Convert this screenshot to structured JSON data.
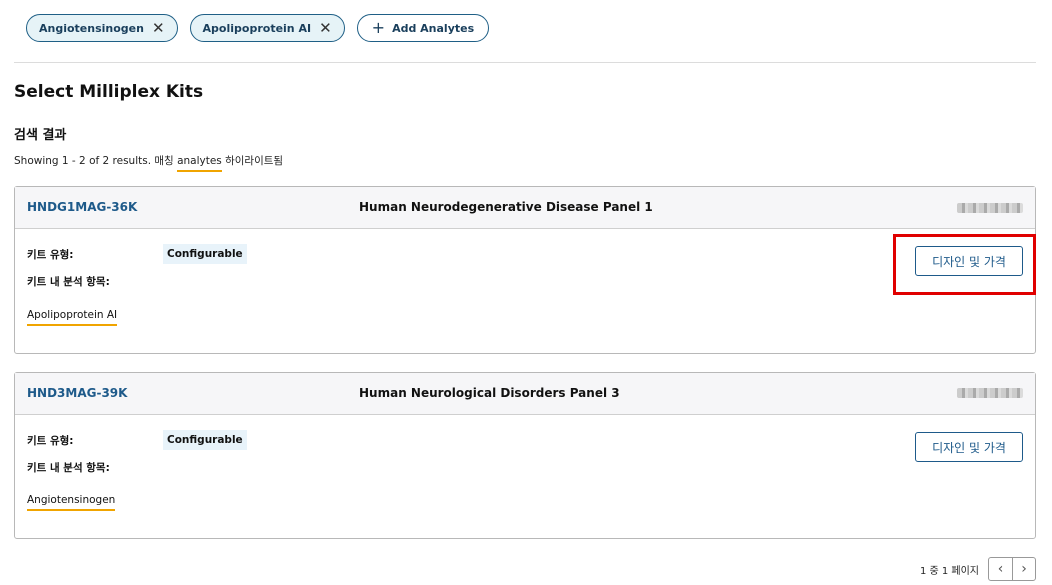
{
  "chips": [
    {
      "label": "Angiotensinogen",
      "remove_icon": "close-icon"
    },
    {
      "label": "Apolipoprotein AI",
      "remove_icon": "close-icon"
    }
  ],
  "add_chip": {
    "label": "Add Analytes",
    "icon": "plus-icon"
  },
  "title": "Select Milliplex Kits",
  "results_heading": "검색 결과",
  "summary": {
    "prefix": "Showing 1 - 2 of 2 results. 매칭 ",
    "highlight": "analytes",
    "suffix": " 하이라이트됨"
  },
  "kits": [
    {
      "code": "HNDG1MAG-36K",
      "name": "Human Neurodegenerative Disease Panel 1",
      "kit_type_label": "키트 유형:",
      "kit_type": "Configurable",
      "analytes_label": "키트 내 분석 항목:",
      "analyte": "Apolipoprotein AI",
      "action": "디자인 및 가격"
    },
    {
      "code": "HND3MAG-39K",
      "name": "Human Neurological Disorders Panel 3",
      "kit_type_label": "키트 유형:",
      "kit_type": "Configurable",
      "analytes_label": "키트 내 분석 항목:",
      "analyte": "Angiotensinogen",
      "action": "디자인 및 가격"
    }
  ],
  "pagination": {
    "text": "1 중 1 페이지",
    "prev_icon": "chevron-left-icon",
    "next_icon": "chevron-right-icon"
  },
  "colors": {
    "accent": "#1e5a8a",
    "highlight": "#f0a400",
    "annotation": "#e00000"
  }
}
